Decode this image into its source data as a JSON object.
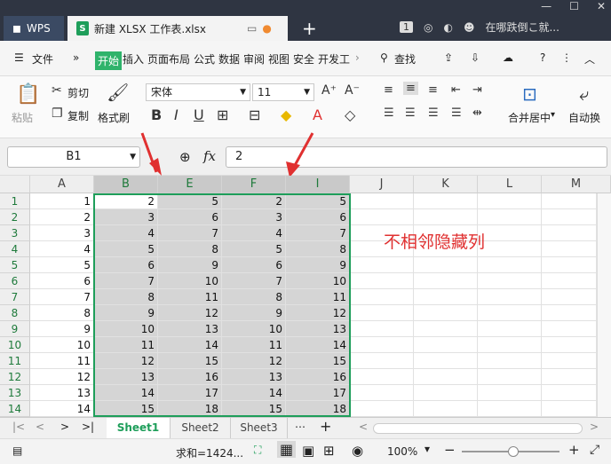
{
  "app": {
    "brand": "WPS",
    "doc_tab": "新建 XLSX 工作表.xlsx",
    "tab_badge": "1",
    "search_prompt": "在哪跌倒こ就..."
  },
  "menu": {
    "file": "文件",
    "items": [
      "开始",
      "插入",
      "页面布局",
      "公式",
      "数据",
      "审阅",
      "视图",
      "安全",
      "开发工"
    ],
    "active": "开始",
    "search": "查找"
  },
  "ribbon": {
    "paste": "粘贴",
    "cut": "剪切",
    "copy": "复制",
    "format_painter": "格式刷",
    "font_name": "宋体",
    "font_size": "11",
    "merge": "合并居中",
    "wrap": "自动换"
  },
  "formula": {
    "cell_ref": "B1",
    "fx": "fx",
    "value": "2"
  },
  "columns": [
    "A",
    "B",
    "E",
    "F",
    "I",
    "J",
    "K",
    "L",
    "M"
  ],
  "rows": [
    [
      1,
      2,
      5,
      2,
      5
    ],
    [
      2,
      3,
      6,
      3,
      6
    ],
    [
      3,
      4,
      7,
      4,
      7
    ],
    [
      4,
      5,
      8,
      5,
      8
    ],
    [
      5,
      6,
      9,
      6,
      9
    ],
    [
      6,
      7,
      10,
      7,
      10
    ],
    [
      7,
      8,
      11,
      8,
      11
    ],
    [
      8,
      9,
      12,
      9,
      12
    ],
    [
      9,
      10,
      13,
      10,
      13
    ],
    [
      10,
      11,
      14,
      11,
      14
    ],
    [
      11,
      12,
      15,
      12,
      15
    ],
    [
      12,
      13,
      16,
      13,
      16
    ],
    [
      13,
      14,
      17,
      14,
      17
    ],
    [
      14,
      15,
      18,
      15,
      18
    ]
  ],
  "annotation": "不相邻隐藏列",
  "sheets": [
    "Sheet1",
    "Sheet2",
    "Sheet3"
  ],
  "status": {
    "sum": "求和=1424...",
    "zoom": "100%"
  },
  "colors": {
    "accent": "#1e9e5a",
    "annotation": "#e03030"
  }
}
